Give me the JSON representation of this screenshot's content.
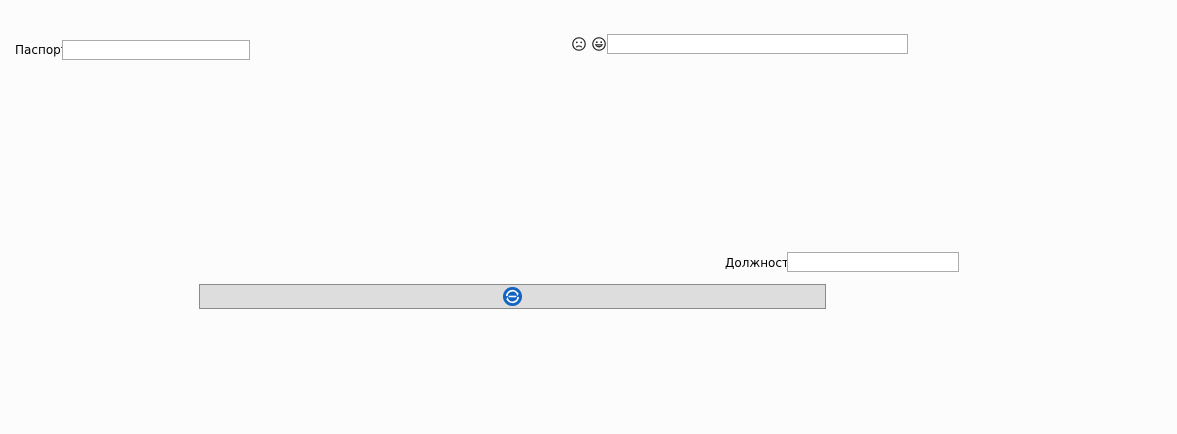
{
  "passport": {
    "label": "Паспорт",
    "value": ""
  },
  "top_right": {
    "icons": [
      "sad-face-icon",
      "grinning-face-icon"
    ],
    "value": ""
  },
  "position": {
    "label": "Должность",
    "value": ""
  },
  "action_bar": {
    "icon": "sync-icon",
    "accent_color": "#1565c0"
  }
}
